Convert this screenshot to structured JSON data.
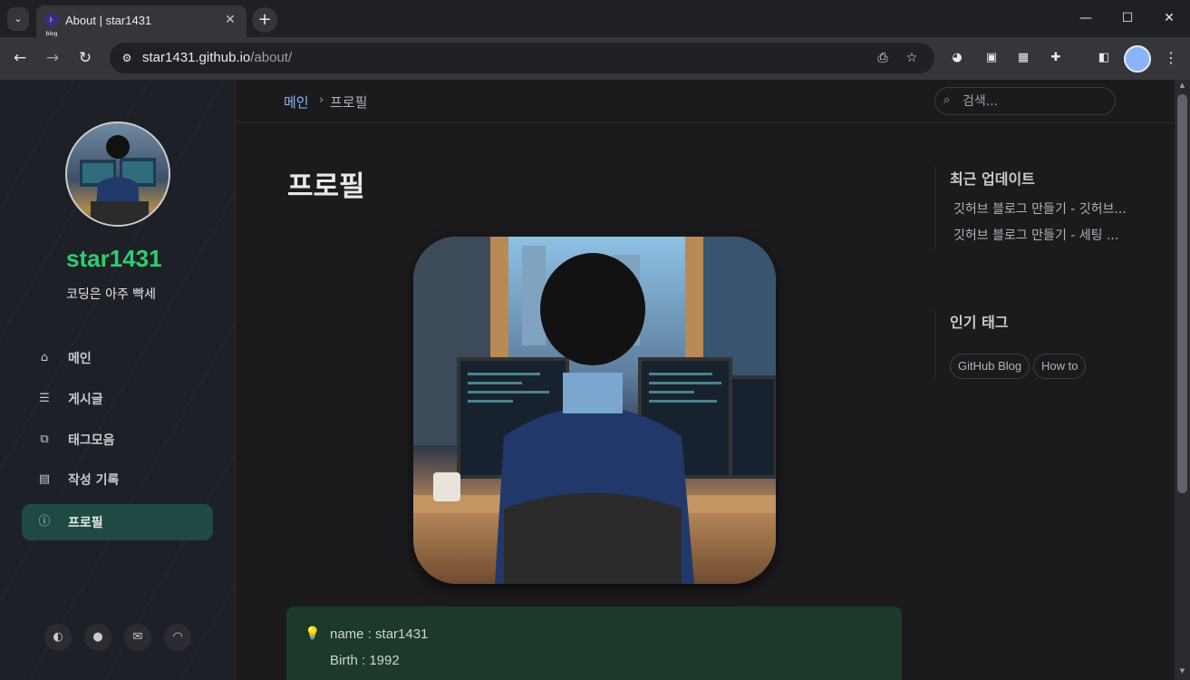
{
  "browser": {
    "tab_title": "About | star1431",
    "favicon_text": "J-blog",
    "url_host": "star1431.github.io",
    "url_path": "/about/",
    "window_controls": {
      "minimize": "—",
      "maximize": "☐",
      "close": "✕"
    }
  },
  "sidebar": {
    "site_title": "star1431",
    "site_subtitle": "코딩은 아주 빡세",
    "nav_items": [
      {
        "label": "메인",
        "icon": "home-icon"
      },
      {
        "label": "게시글",
        "icon": "list-icon"
      },
      {
        "label": "태그모음",
        "icon": "tags-icon"
      },
      {
        "label": "작성 기록",
        "icon": "archive-icon"
      },
      {
        "label": "프로필",
        "icon": "info-icon",
        "active": true
      }
    ],
    "social": [
      "theme-toggle-icon",
      "github-icon",
      "email-icon",
      "rss-icon"
    ]
  },
  "topbar": {
    "breadcrumb_home": "메인",
    "breadcrumb_current": "프로필",
    "search_placeholder": "검색..."
  },
  "content": {
    "title": "프로필",
    "info_lines": [
      "name : star1431",
      "Birth : 1992"
    ]
  },
  "panels": {
    "recent_heading": "최근 업데이트",
    "recent_items": [
      "깃허브 블로그 만들기 - 깃허브...",
      "깃허브 블로그 만들기 - 세팅 ..."
    ],
    "tags_heading": "인기 태그",
    "tags": [
      "GitHub Blog",
      "How to"
    ]
  },
  "colors": {
    "accent": "#2ecc71",
    "active_nav_bg": "#1f4a44",
    "link": "#8ab4f8",
    "callout_bg": "#1b3a2a"
  }
}
